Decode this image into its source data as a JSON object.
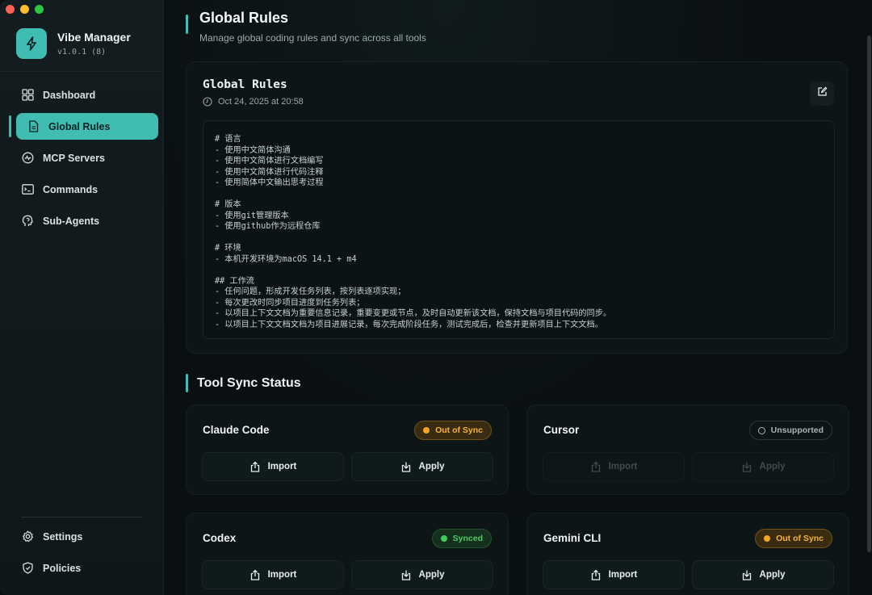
{
  "app": {
    "name": "Vibe Manager",
    "version": "v1.0.1 (8)"
  },
  "sidebar": {
    "items": [
      {
        "label": "Dashboard",
        "icon": "dashboard-grid-icon"
      },
      {
        "label": "Global Rules",
        "icon": "document-icon",
        "active": true
      },
      {
        "label": "MCP Servers",
        "icon": "server-pulse-icon"
      },
      {
        "label": "Commands",
        "icon": "terminal-icon"
      },
      {
        "label": "Sub-Agents",
        "icon": "agent-head-icon"
      }
    ],
    "bottom": [
      {
        "label": "Settings",
        "icon": "gear-icon"
      },
      {
        "label": "Policies",
        "icon": "shield-icon"
      }
    ]
  },
  "page": {
    "title": "Global Rules",
    "subtitle": "Manage global coding rules and sync across all tools"
  },
  "rules": {
    "title": "Global Rules",
    "date": "Oct 24, 2025 at 20:58",
    "content": "# 语言\n- 使用中文简体沟通\n- 使用中文简体进行文档编写\n- 使用中文简体进行代码注释\n- 使用简体中文输出思考过程\n\n# 版本\n- 使用git管理版本\n- 使用github作为远程仓库\n\n# 环境\n- 本机开发环境为macOS 14.1 + m4\n\n## 工作流\n- 任何问题，形成开发任务列表，按列表逐项实现；\n- 每次更改时同步项目进度到任务列表；\n- 以项目上下文文档为重要信息记录，重要变更或节点，及时自动更新该文档，保持文档与项目代码的同步。\n- 以项目上下文文档文档为项目进展记录，每次完成阶段任务，测试完成后，检查并更新项目上下文文档。"
  },
  "sync": {
    "title": "Tool Sync Status",
    "import_label": "Import",
    "apply_label": "Apply",
    "tools": [
      {
        "name": "Claude Code",
        "status": "Out of Sync"
      },
      {
        "name": "Cursor",
        "status": "Unsupported"
      },
      {
        "name": "Codex",
        "status": "Synced"
      },
      {
        "name": "Gemini CLI",
        "status": "Out of Sync"
      }
    ]
  },
  "colors": {
    "accent": "#3fbdb2",
    "warning": "#f4a623",
    "success": "#3fcf60"
  }
}
